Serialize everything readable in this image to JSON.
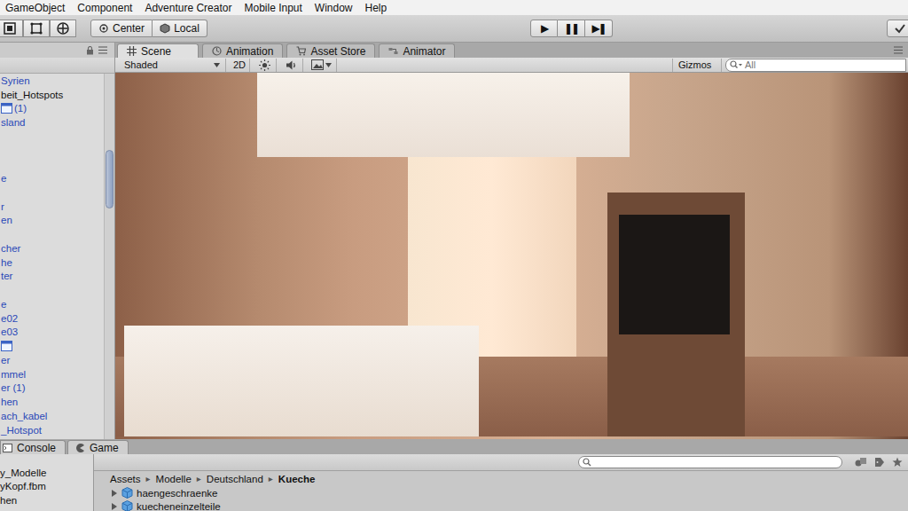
{
  "menu": [
    "GameObject",
    "Component",
    "Adventure Creator",
    "Mobile Input",
    "Window",
    "Help"
  ],
  "toolbar": {
    "pivot": [
      {
        "label": "Center"
      },
      {
        "label": "Local"
      }
    ],
    "playback": [
      {
        "label": "▶",
        "selected": false
      },
      {
        "label": "❚❚",
        "selected": false
      },
      {
        "label": "▶❚",
        "selected": false
      }
    ]
  },
  "hierarchy": {
    "items": [
      {
        "label": "Syrien",
        "kind": "text",
        "prefab": true
      },
      {
        "label": "beit_Hotspots",
        "kind": "text",
        "prefab": false
      },
      {
        "label": "(1)",
        "kind": "icon",
        "prefab": true
      },
      {
        "label": "sland",
        "kind": "text",
        "prefab": true
      },
      {
        "label": "",
        "kind": "blank",
        "prefab": false
      },
      {
        "label": "",
        "kind": "blank",
        "prefab": false
      },
      {
        "label": "",
        "kind": "blank",
        "prefab": false
      },
      {
        "label": "e",
        "kind": "text",
        "prefab": true
      },
      {
        "label": "",
        "kind": "blank",
        "prefab": false
      },
      {
        "label": "r",
        "kind": "text",
        "prefab": true
      },
      {
        "label": "en",
        "kind": "text",
        "prefab": true
      },
      {
        "label": "",
        "kind": "blank",
        "prefab": false
      },
      {
        "label": "cher",
        "kind": "text",
        "prefab": true
      },
      {
        "label": "he",
        "kind": "text",
        "prefab": true
      },
      {
        "label": "ter",
        "kind": "text",
        "prefab": true
      },
      {
        "label": "",
        "kind": "blank",
        "prefab": false
      },
      {
        "label": "e",
        "kind": "text",
        "prefab": true
      },
      {
        "label": "e02",
        "kind": "text",
        "prefab": true
      },
      {
        "label": "e03",
        "kind": "text",
        "prefab": true
      },
      {
        "label": "",
        "kind": "icon",
        "prefab": true
      },
      {
        "label": "er",
        "kind": "text",
        "prefab": true
      },
      {
        "label": "mmel",
        "kind": "text",
        "prefab": true
      },
      {
        "label": "er (1)",
        "kind": "text",
        "prefab": true
      },
      {
        "label": "hen",
        "kind": "text",
        "prefab": true
      },
      {
        "label": "ach_kabel",
        "kind": "text",
        "prefab": true
      },
      {
        "label": "_Hotspot",
        "kind": "text",
        "prefab": true
      }
    ]
  },
  "scene_view": {
    "tabs": [
      {
        "label": "Scene",
        "selected": true
      },
      {
        "label": "Animation",
        "selected": false
      },
      {
        "label": "Asset Store",
        "selected": false
      },
      {
        "label": "Animator",
        "selected": false
      }
    ],
    "shading": "Shaded",
    "mode_2d": {
      "label": "2D",
      "on": false
    },
    "gizmos": "Gizmos",
    "search": {
      "placeholder": "All"
    }
  },
  "bottom_tabs": [
    {
      "label": "Console",
      "selected": false
    },
    {
      "label": "Game",
      "selected": false
    }
  ],
  "project": {
    "folders": [
      "y_Modelle",
      "yKopf.fbm",
      "hen"
    ],
    "breadcrumb": [
      {
        "label": "Assets",
        "current": false
      },
      {
        "label": "Modelle",
        "current": false
      },
      {
        "label": "Deutschland",
        "current": false
      },
      {
        "label": "Kueche",
        "current": true
      }
    ],
    "separator": "▸",
    "assets": [
      {
        "label": "haengeschraenke",
        "expanded": false
      },
      {
        "label": "kuecheneinzelteile",
        "expanded": false
      }
    ]
  }
}
